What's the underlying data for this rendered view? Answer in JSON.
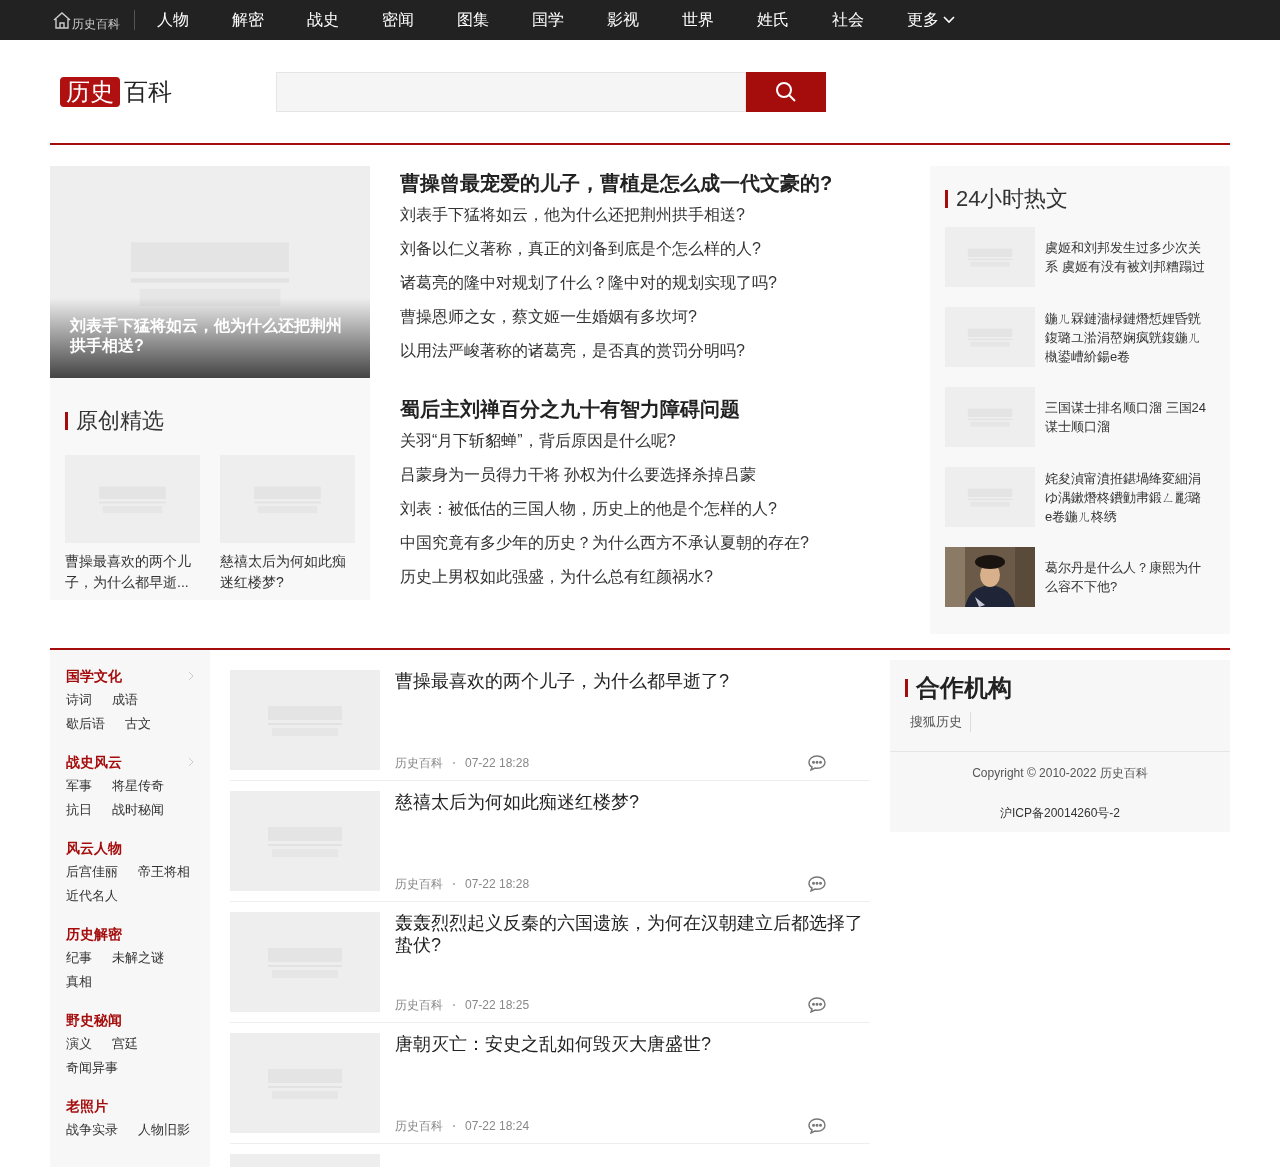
{
  "nav": {
    "home_label": "历史百科",
    "items": [
      "人物",
      "解密",
      "战史",
      "密闻",
      "图集",
      "国学",
      "影视",
      "世界",
      "姓氏",
      "社会"
    ],
    "more": "更多"
  },
  "logo": {
    "red": "历史",
    "black": "百科"
  },
  "featured": {
    "caption": "刘表手下猛将如云，他为什么还把荆州拱手相送?"
  },
  "originals": {
    "title": "原创精选",
    "items": [
      {
        "title": "曹操最喜欢的两个儿子，为什么都早逝..."
      },
      {
        "title": "慈禧太后为何如此痴迷红楼梦?"
      }
    ]
  },
  "headline_groups": [
    {
      "title": "曹操曾最宠爱的儿子，曹植是怎么成一代文豪的?",
      "links": [
        "刘表手下猛将如云，他为什么还把荆州拱手相送?",
        "刘备以仁义著称，真正的刘备到底是个怎么样的人?",
        "诸葛亮的隆中对规划了什么？隆中对的规划实现了吗?",
        "曹操恩师之女，蔡文姬一生婚姻有多坎坷?",
        "以用法严峻著称的诸葛亮，是否真的赏罚分明吗?"
      ]
    },
    {
      "title": "蜀后主刘禅百分之九十有智力障碍问题",
      "links": [
        "关羽“月下斩貂蝉”，背后原因是什么呢?",
        "吕蒙身为一员得力干将 孙权为什么要选择杀掉吕蒙",
        "刘表：被低估的三国人物，历史上的他是个怎样的人?",
        "中国究竟有多少年的历史？为什么西方不承认夏朝的存在?",
        "历史上男权如此强盛，为什么总有红颜祸水?"
      ]
    }
  ],
  "hot": {
    "title": "24小时热文",
    "items": [
      {
        "title": "虞姬和刘邦发生过多少次关系 虞姬有没有被刘邦糟蹋过",
        "kind": "placeholder"
      },
      {
        "title": "鍦ㄦ槑鏈濇椂鏈熸惁娌昏皝鍑璐ユ湁涓嶅娴疯皝鍑鍦ㄦ槸鍙嶆紒鍚e卷",
        "kind": "placeholder"
      },
      {
        "title": "三国谋士排名顺口溜 三国24谋士顺口溜",
        "kind": "placeholder"
      },
      {
        "title": "姹夋湞甯濆拰鍖堝绛変細涓ゆ湡鏉熸柊鐨勭帇鍛ㄥ彲璐e卷鍦ㄦ柊绣",
        "kind": "placeholder"
      },
      {
        "title": "葛尔丹是什么人？康熙为什么容不下他?"
      }
    ]
  },
  "categories": [
    {
      "title": "国学文化",
      "has_arrow": true,
      "links": [
        "诗词",
        "成语",
        "歇后语",
        "古文"
      ]
    },
    {
      "title": "战史风云",
      "has_arrow": true,
      "links": [
        "军事",
        "将星传奇",
        "抗日",
        "战时秘闻"
      ]
    },
    {
      "title": "风云人物",
      "has_arrow": false,
      "links": [
        "后宫佳丽",
        "帝王将相",
        "近代名人"
      ]
    },
    {
      "title": "历史解密",
      "has_arrow": false,
      "links": [
        "纪事",
        "未解之谜",
        "真相"
      ]
    },
    {
      "title": "野史秘闻",
      "has_arrow": false,
      "links": [
        "演义",
        "宫廷",
        "奇闻异事"
      ]
    },
    {
      "title": "老照片",
      "has_arrow": false,
      "links": [
        "战争实录",
        "人物旧影"
      ]
    }
  ],
  "articles": [
    {
      "title": "曹操最喜欢的两个儿子，为什么都早逝了?",
      "source": "历史百科",
      "time": "07-22 18:28"
    },
    {
      "title": "慈禧太后为何如此痴迷红楼梦?",
      "source": "历史百科",
      "time": "07-22 18:28"
    },
    {
      "title": "轰轰烈烈起义反秦的六国遗族，为何在汉朝建立后都选择了蛰伏?",
      "source": "历史百科",
      "time": "07-22 18:25"
    },
    {
      "title": "唐朝灭亡：安史之乱如何毁灭大唐盛世?",
      "source": "历史百科",
      "time": "07-22 18:24"
    }
  ],
  "partners": {
    "title": "合作机构",
    "links": [
      "搜狐历史"
    ]
  },
  "footer": {
    "copyright": "Copyright © 2010-2022 历史百科",
    "icp": "沪ICP备20014260号-2"
  }
}
